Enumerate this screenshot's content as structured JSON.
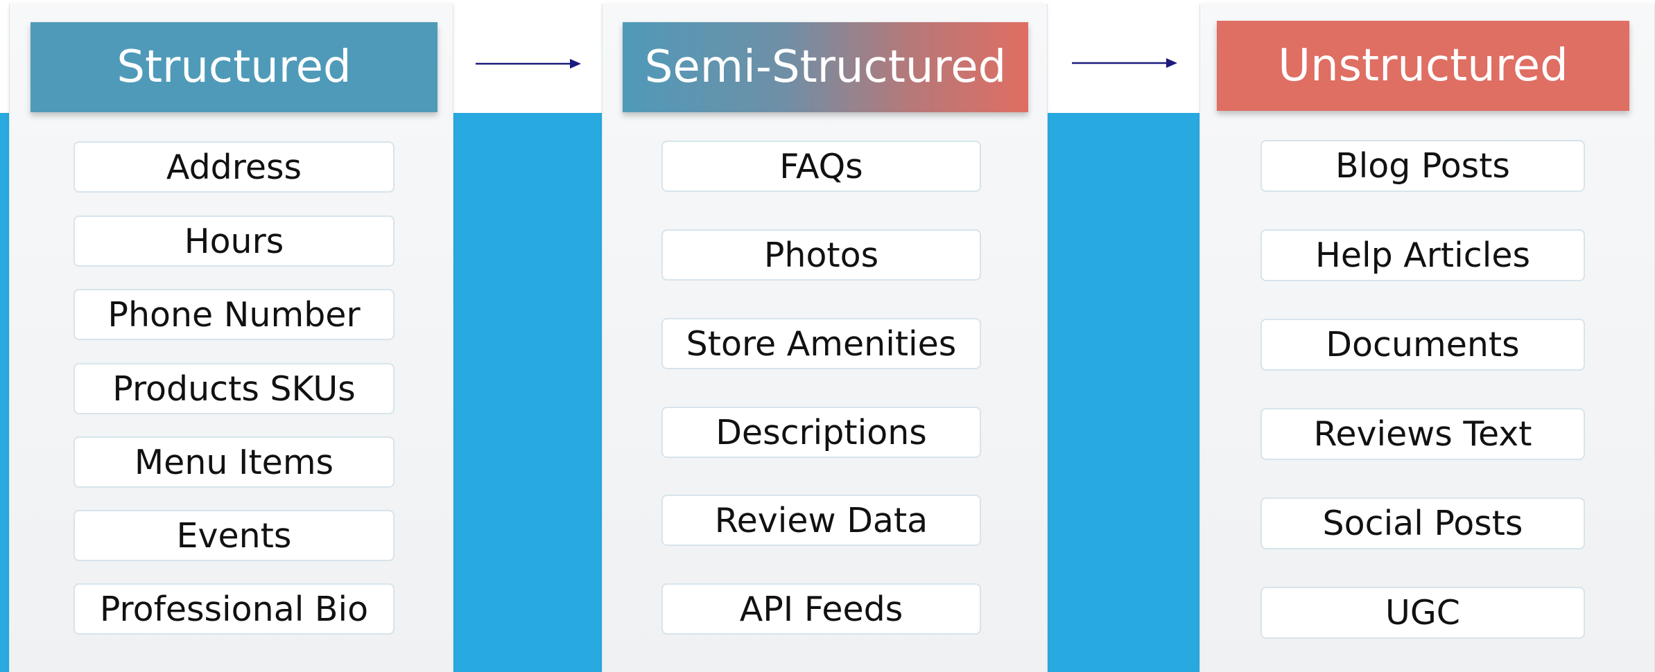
{
  "colors": {
    "band": "#28a9e0",
    "structured": "#4f9ab9",
    "unstructured": "#df6e63",
    "arrow": "#1b1a7e"
  },
  "columns": [
    {
      "title": "Structured",
      "items": [
        "Address",
        "Hours",
        "Phone Number",
        "Products SKUs",
        "Menu Items",
        "Events",
        "Professional Bio"
      ]
    },
    {
      "title": "Semi-Structured",
      "items": [
        "FAQs",
        "Photos",
        "Store Amenities",
        "Descriptions",
        "Review Data",
        "API Feeds"
      ]
    },
    {
      "title": "Unstructured",
      "items": [
        "Blog Posts",
        "Help Articles",
        "Documents",
        "Reviews Text",
        "Social Posts",
        "UGC"
      ]
    }
  ]
}
